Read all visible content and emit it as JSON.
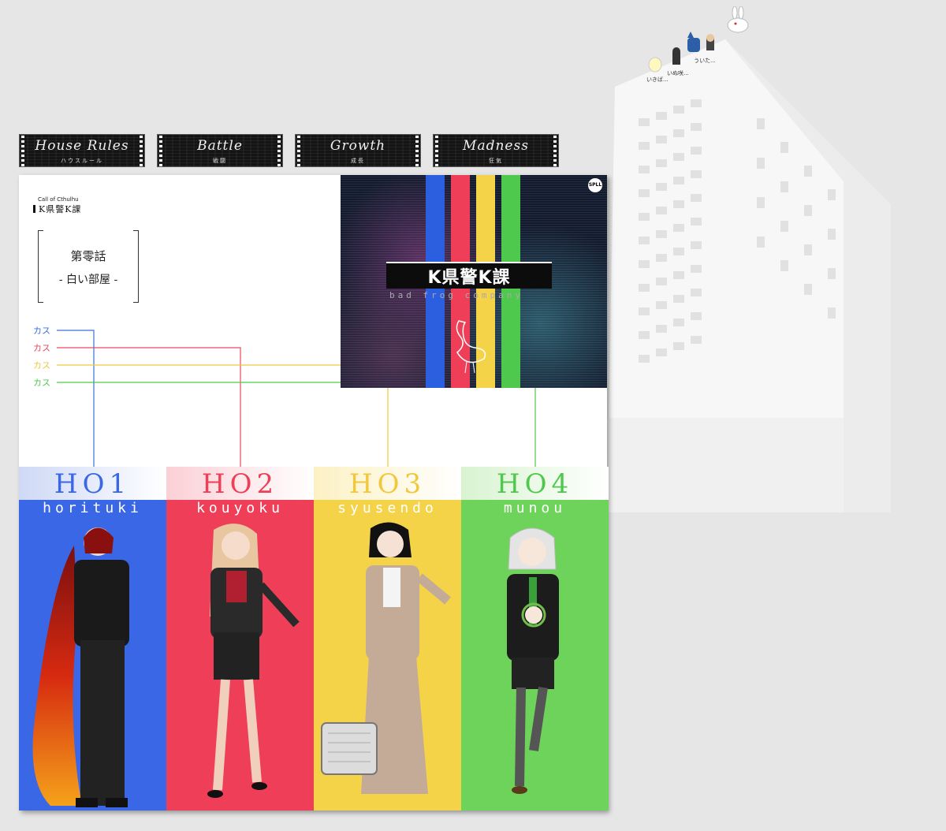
{
  "tabs": [
    {
      "label": "House Rules",
      "sub": "ハウスルール"
    },
    {
      "label": "Battle",
      "sub": "戦闘"
    },
    {
      "label": "Growth",
      "sub": "成長"
    },
    {
      "label": "Madness",
      "sub": "狂気"
    }
  ],
  "header": {
    "system": "Call of Cthulhu",
    "title": "K県警K課",
    "episode": "第零話",
    "room": "- 白い部屋 -"
  },
  "kasu": [
    {
      "label": "カス",
      "color": "#3b6fe0"
    },
    {
      "label": "カス",
      "color": "#e84a5f"
    },
    {
      "label": "カス",
      "color": "#f0c83a"
    },
    {
      "label": "カス",
      "color": "#4ec94e"
    }
  ],
  "poster": {
    "title": "K県警K課",
    "subtitle": "bad frog company",
    "badge": "SPLL"
  },
  "characters": [
    {
      "ho": "HO1",
      "name": "horituki",
      "bg": "#3a67e6",
      "hdr": "#3a67e6"
    },
    {
      "ho": "HO2",
      "name": "kouyoku",
      "bg": "#ef3e57",
      "hdr": "#ef3e57"
    },
    {
      "ho": "HO3",
      "name": "syusendo",
      "bg": "#f4d349",
      "hdr": "#f4d349"
    },
    {
      "ho": "HO4",
      "name": "munou",
      "bg": "#6ed35a",
      "hdr": "#6ed35a"
    }
  ],
  "avatars": [
    {
      "label": "いきば..."
    },
    {
      "label": "いぬ咲..."
    },
    {
      "label": "ういた..."
    }
  ]
}
